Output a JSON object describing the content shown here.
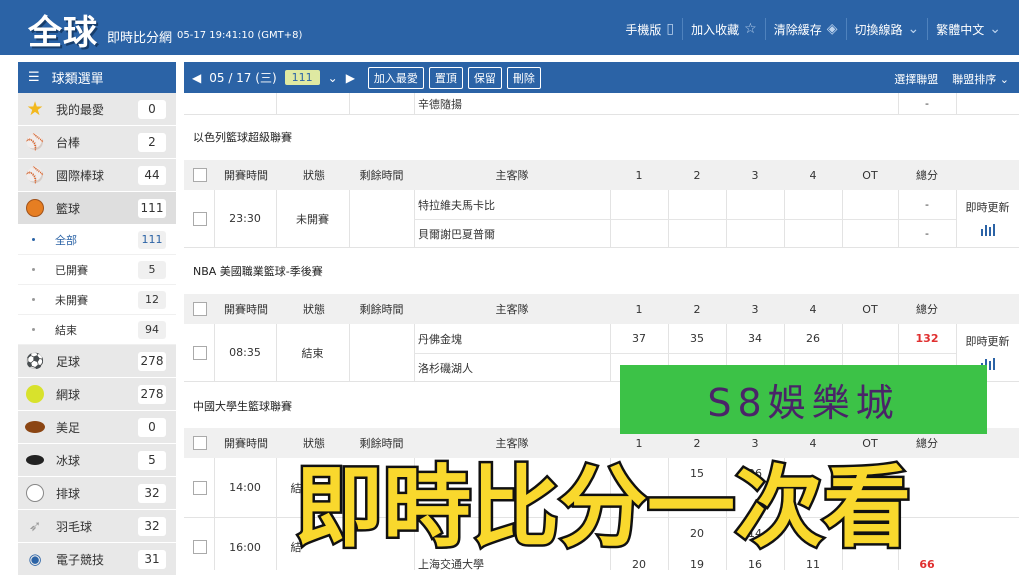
{
  "header": {
    "logo": "全球",
    "subtitle": "即時比分網",
    "datetime": "05-17 19:41:10 (GMT+8)",
    "menu": [
      {
        "label": "手機版",
        "icon": "phone-icon"
      },
      {
        "label": "加入收藏",
        "icon": "star-icon"
      },
      {
        "label": "清除緩存",
        "icon": "broom-icon"
      },
      {
        "label": "切換線路",
        "icon": "chevron-down-icon"
      },
      {
        "label": "繁體中文",
        "icon": "chevron-down-icon"
      }
    ]
  },
  "sidebar": {
    "title": "球類選單",
    "items": [
      {
        "label": "我的最愛",
        "count": "0",
        "icon": "star-icon"
      },
      {
        "label": "台棒",
        "count": "2",
        "icon": "baseball-icon"
      },
      {
        "label": "國際棒球",
        "count": "44",
        "icon": "baseball-icon"
      },
      {
        "label": "籃球",
        "count": "111",
        "icon": "basketball-icon"
      }
    ],
    "sub_items": [
      {
        "label": "全部",
        "count": "111"
      },
      {
        "label": "已開賽",
        "count": "5"
      },
      {
        "label": "未開賽",
        "count": "12"
      },
      {
        "label": "結束",
        "count": "94"
      }
    ],
    "items2": [
      {
        "label": "足球",
        "count": "278",
        "icon": "soccer-icon"
      },
      {
        "label": "網球",
        "count": "278",
        "icon": "tennis-icon"
      },
      {
        "label": "美足",
        "count": "0",
        "icon": "american-football-icon"
      },
      {
        "label": "冰球",
        "count": "5",
        "icon": "hockey-puck-icon"
      },
      {
        "label": "排球",
        "count": "32",
        "icon": "volleyball-icon"
      },
      {
        "label": "羽毛球",
        "count": "32",
        "icon": "badminton-icon"
      },
      {
        "label": "電子競技",
        "count": "31",
        "icon": "gamepad-icon"
      }
    ]
  },
  "toolbar": {
    "date": "05 / 17 (三)",
    "count": "111",
    "buttons": [
      "加入最愛",
      "置頂",
      "保留",
      "刪除"
    ],
    "right": [
      "選擇聯盟",
      "聯盟排序"
    ]
  },
  "table": {
    "headers": [
      "開賽時間",
      "狀態",
      "剩餘時間",
      "主客隊",
      "1",
      "2",
      "3",
      "4",
      "OT",
      "總分"
    ],
    "update_label": "即時更新",
    "top_team": "辛德隨揚",
    "top_total": "-",
    "leagues": [
      {
        "name": "以色列籃球超級聯賽",
        "games": [
          {
            "time": "23:30",
            "status": "未開賽",
            "teams": [
              "特拉維夫馬卡比",
              "貝爾謝巴夏普爾"
            ],
            "scores": [
              [
                "",
                "",
                "",
                "",
                "",
                "-"
              ],
              [
                "",
                "",
                "",
                "",
                "",
                "-"
              ]
            ]
          }
        ]
      },
      {
        "name": "NBA 美國職業籃球-季後賽",
        "games": [
          {
            "time": "08:35",
            "status": "結束",
            "teams": [
              "丹佛金塊",
              "洛杉磯湖人"
            ],
            "scores": [
              [
                "37",
                "35",
                "34",
                "26",
                "",
                "132"
              ],
              [
                "",
                "",
                "",
                "",
                "",
                ""
              ]
            ]
          }
        ]
      },
      {
        "name": "中國大學生籃球聯賽",
        "games": [
          {
            "time": "14:00",
            "status": "結",
            "teams": [
              "",
              ""
            ],
            "scores": [
              [
                "",
                "15",
                "26",
                "",
                "",
                ""
              ],
              [
                "",
                "",
                "",
                "",
                "",
                ""
              ]
            ]
          },
          {
            "time": "16:00",
            "status": "結",
            "teams": [
              "",
              "上海交通大學"
            ],
            "scores": [
              [
                "",
                "20",
                "14",
                "",
                "",
                ""
              ],
              [
                "20",
                "19",
                "16",
                "11",
                "",
                "66"
              ]
            ]
          }
        ]
      }
    ]
  },
  "banner": {
    "text": "S8娛樂城"
  },
  "caption": {
    "text": "即時比分一次看"
  },
  "colors": {
    "primary": "#2b63a6",
    "banner_green": "#3cc247",
    "caption_yellow": "#f9d82d",
    "score_red": "#e03030"
  }
}
